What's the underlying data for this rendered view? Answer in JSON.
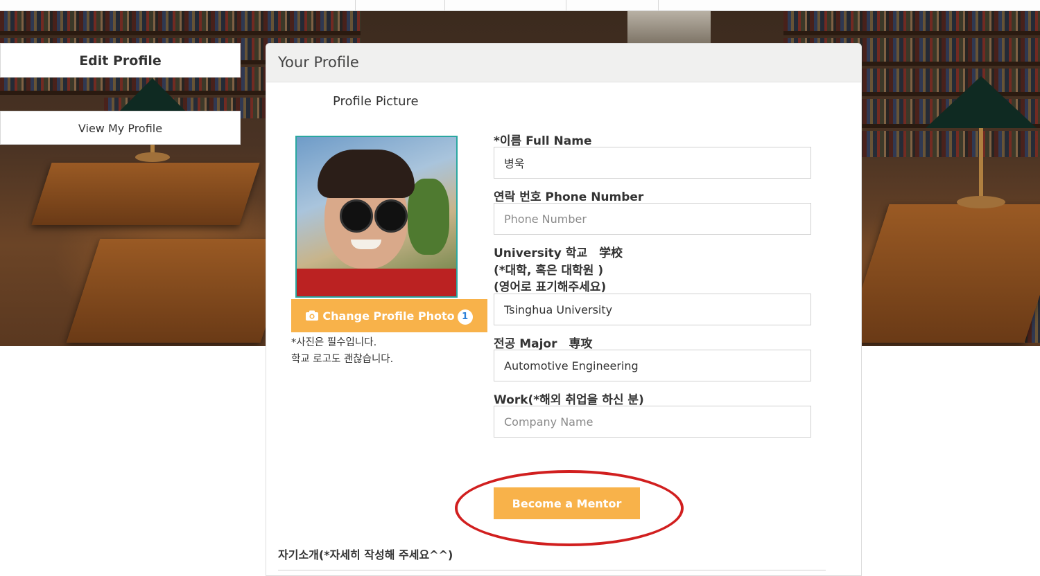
{
  "side_nav": {
    "edit_profile": "Edit Profile",
    "view_profile": "View My Profile"
  },
  "card": {
    "title": "Your Profile",
    "picture_title": "Profile Picture",
    "change_photo_label": "Change Profile Photo",
    "change_photo_badge": "1",
    "photo_note_1": "*사진은 필수입니다.",
    "photo_note_2": "학교 로고도 괜찮습니다."
  },
  "form": {
    "full_name_label": "*이름 Full Name",
    "full_name_value": "병욱",
    "phone_label": "연락 번호 Phone Number",
    "phone_placeholder": "Phone Number",
    "university_label_1": "University 학교　学校",
    "university_label_2": "(*대학, 혹은 대학원 )",
    "university_label_3": "(영어로 표기해주세요)",
    "university_value": "Tsinghua University",
    "major_label": "전공 Major　専攻",
    "major_value": "Automotive Engineering",
    "work_label": "Work(*해외 취업을 하신 분)",
    "work_placeholder": "Company Name"
  },
  "actions": {
    "become_mentor": "Become a Mentor"
  },
  "intro": {
    "label": "자기소개(*자세히 작성해 주세요^^)"
  },
  "colors": {
    "accent_orange": "#f8b24a",
    "highlight_red": "#d11f1f",
    "photo_border": "#2aa7a0"
  }
}
